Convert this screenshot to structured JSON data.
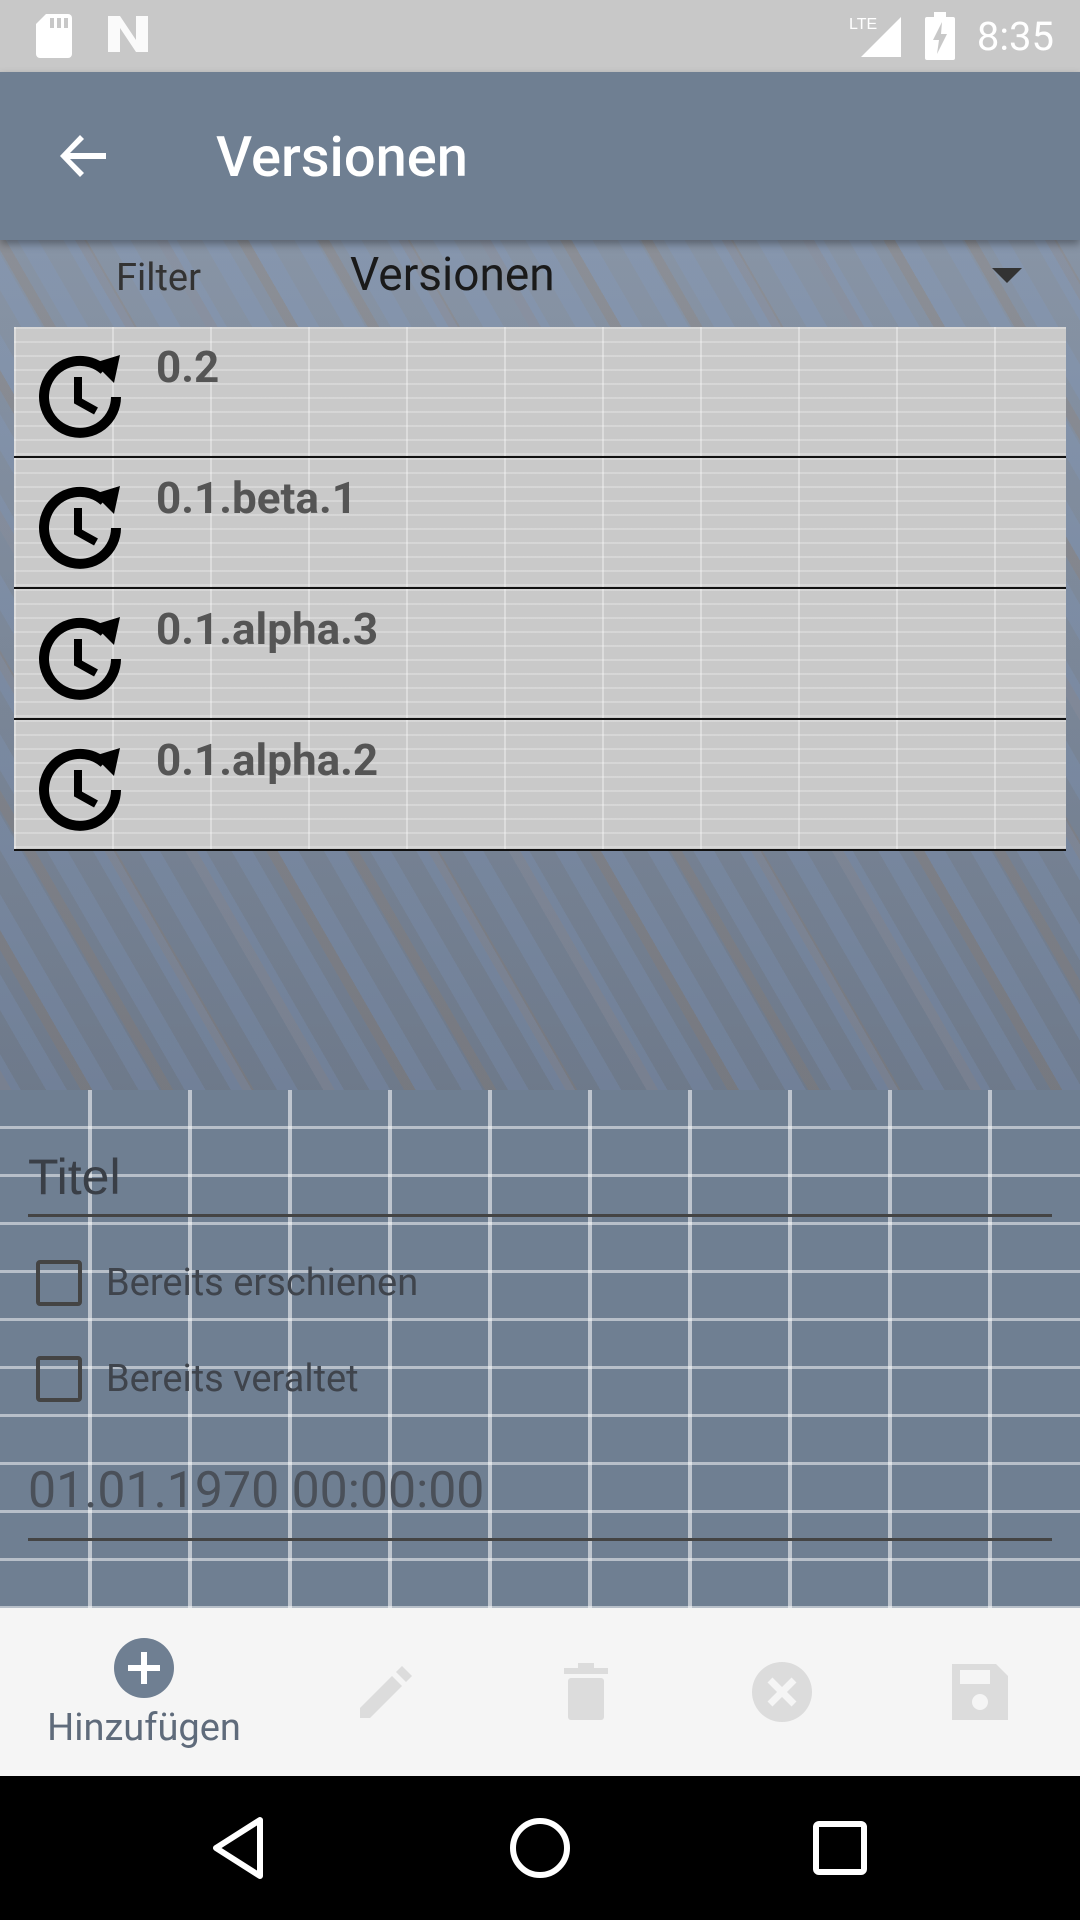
{
  "status_bar": {
    "time": "8:35",
    "icons": [
      "sd-card-icon",
      "n-logo-icon",
      "lte-signal-icon",
      "battery-charging-icon"
    ]
  },
  "toolbar": {
    "title": "Versionen",
    "back_icon": "arrow-back-icon"
  },
  "filter": {
    "label": "Filter",
    "selected": "Versionen"
  },
  "versions": [
    {
      "label": "0.2"
    },
    {
      "label": "0.1.beta.1"
    },
    {
      "label": "0.1.alpha.3"
    },
    {
      "label": "0.1.alpha.2"
    }
  ],
  "form": {
    "title_placeholder": "Titel",
    "checkbox_released": "Bereits erschienen",
    "checkbox_deprecated": "Bereits veraltet",
    "date_value": "01.01.1970 00:00:00"
  },
  "actions": {
    "add_label": "Hinzufügen",
    "icons": [
      "add-circle-icon",
      "edit-icon",
      "delete-icon",
      "cancel-icon",
      "save-icon"
    ]
  },
  "colors": {
    "primary": "#6f7f92",
    "list_bg": "#c9c9c9",
    "action_bar": "#f5f5f5"
  }
}
